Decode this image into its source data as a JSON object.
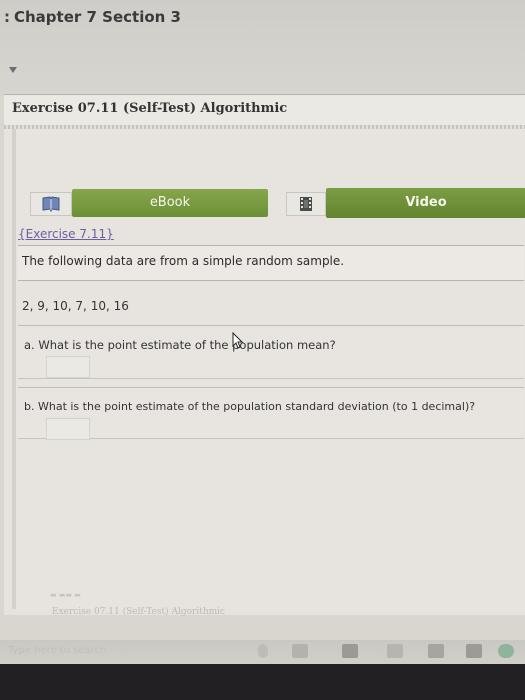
{
  "header": {
    "chapter_title": "Chapter 7 Section 3"
  },
  "exercise": {
    "title": "Exercise 07.11 (Self-Test) Algorithmic"
  },
  "resources": {
    "ebook_label": "eBook",
    "video_label": "Video"
  },
  "question": {
    "link": "{Exercise 7.11}",
    "intro": "The following data are from a simple random sample.",
    "data": "2, 9, 10, 7, 10, 16",
    "part_a": "a. What is the point estimate of the population mean?",
    "part_b": "b. What is the point estimate of the population standard deviation (to 1 decimal)?"
  },
  "footer": {
    "exercise_label": "Exercise 07.11 (Self-Test) Algorithmic"
  },
  "taskbar": {
    "search_placeholder": "Type here to search"
  }
}
